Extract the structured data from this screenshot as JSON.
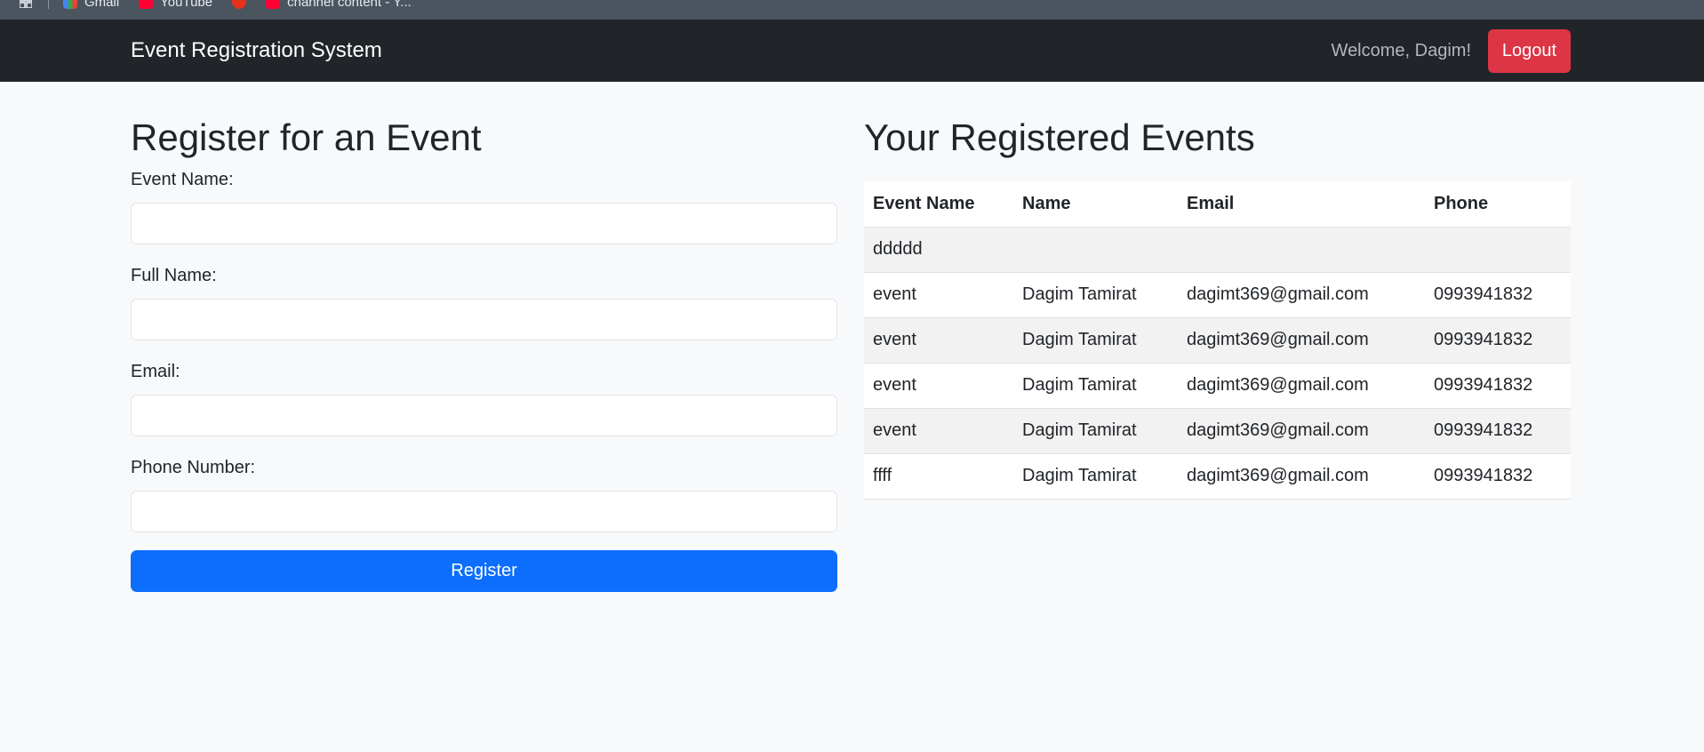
{
  "bookmarks": [
    {
      "icon": "gmail-icon",
      "label": "Gmail"
    },
    {
      "icon": "youtube-icon",
      "label": "YouTube"
    },
    {
      "icon": "p-icon",
      "label": ""
    },
    {
      "icon": "youtube-icon",
      "label": "channel content - Y..."
    }
  ],
  "navbar": {
    "brand": "Event Registration System",
    "welcome": "Welcome, Dagim!",
    "logout_label": "Logout"
  },
  "form": {
    "title": "Register for an Event",
    "fields": [
      {
        "label": "Event Name:",
        "value": ""
      },
      {
        "label": "Full Name:",
        "value": ""
      },
      {
        "label": "Email:",
        "value": ""
      },
      {
        "label": "Phone Number:",
        "value": ""
      }
    ],
    "submit_label": "Register"
  },
  "events": {
    "title": "Your Registered Events",
    "columns": [
      "Event Name",
      "Name",
      "Email",
      "Phone"
    ],
    "rows": [
      [
        "ddddd",
        "",
        "",
        ""
      ],
      [
        "event",
        "Dagim Tamirat",
        "dagimt369@gmail.com",
        "0993941832"
      ],
      [
        "event",
        "Dagim Tamirat",
        "dagimt369@gmail.com",
        "0993941832"
      ],
      [
        "event",
        "Dagim Tamirat",
        "dagimt369@gmail.com",
        "0993941832"
      ],
      [
        "event",
        "Dagim Tamirat",
        "dagimt369@gmail.com",
        "0993941832"
      ],
      [
        "ffff",
        "Dagim Tamirat",
        "dagimt369@gmail.com",
        "0993941832"
      ]
    ]
  },
  "colors": {
    "navbar_bg": "#212529",
    "primary": "#0d6efd",
    "danger": "#dc3545",
    "page_bg": "#f8f9fa"
  }
}
